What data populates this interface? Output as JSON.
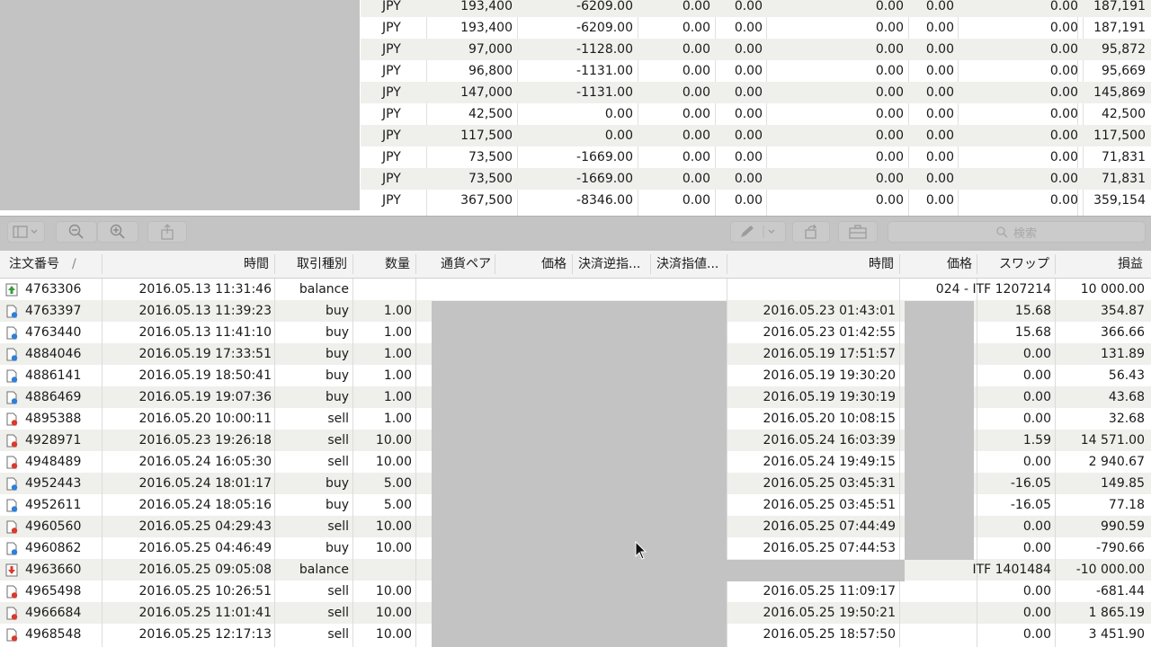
{
  "top_table": {
    "rows": [
      {
        "currency": "JPY",
        "c2": "193,400",
        "c3": "-6209.00",
        "c4": "0.00",
        "c5": "0.00",
        "c6": "0.00",
        "c7": "0.00",
        "c8": "0.00",
        "c9": "187,191"
      },
      {
        "currency": "JPY",
        "c2": "193,400",
        "c3": "-6209.00",
        "c4": "0.00",
        "c5": "0.00",
        "c6": "0.00",
        "c7": "0.00",
        "c8": "0.00",
        "c9": "187,191"
      },
      {
        "currency": "JPY",
        "c2": "97,000",
        "c3": "-1128.00",
        "c4": "0.00",
        "c5": "0.00",
        "c6": "0.00",
        "c7": "0.00",
        "c8": "0.00",
        "c9": "95,872"
      },
      {
        "currency": "JPY",
        "c2": "96,800",
        "c3": "-1131.00",
        "c4": "0.00",
        "c5": "0.00",
        "c6": "0.00",
        "c7": "0.00",
        "c8": "0.00",
        "c9": "95,669"
      },
      {
        "currency": "JPY",
        "c2": "147,000",
        "c3": "-1131.00",
        "c4": "0.00",
        "c5": "0.00",
        "c6": "0.00",
        "c7": "0.00",
        "c8": "0.00",
        "c9": "145,869"
      },
      {
        "currency": "JPY",
        "c2": "42,500",
        "c3": "0.00",
        "c4": "0.00",
        "c5": "0.00",
        "c6": "0.00",
        "c7": "0.00",
        "c8": "0.00",
        "c9": "42,500"
      },
      {
        "currency": "JPY",
        "c2": "117,500",
        "c3": "0.00",
        "c4": "0.00",
        "c5": "0.00",
        "c6": "0.00",
        "c7": "0.00",
        "c8": "0.00",
        "c9": "117,500"
      },
      {
        "currency": "JPY",
        "c2": "73,500",
        "c3": "-1669.00",
        "c4": "0.00",
        "c5": "0.00",
        "c6": "0.00",
        "c7": "0.00",
        "c8": "0.00",
        "c9": "71,831"
      },
      {
        "currency": "JPY",
        "c2": "73,500",
        "c3": "-1669.00",
        "c4": "0.00",
        "c5": "0.00",
        "c6": "0.00",
        "c7": "0.00",
        "c8": "0.00",
        "c9": "71,831"
      },
      {
        "currency": "JPY",
        "c2": "367,500",
        "c3": "-8346.00",
        "c4": "0.00",
        "c5": "0.00",
        "c6": "0.00",
        "c7": "0.00",
        "c8": "0.00",
        "c9": "359,154"
      }
    ]
  },
  "toolbar": {
    "search_placeholder": "検索",
    "icons": [
      "sidebar-toggle-icon",
      "zoom-out-icon",
      "zoom-in-icon",
      "share-icon",
      "pencil-icon",
      "rotate-icon",
      "briefcase-icon",
      "search-icon"
    ]
  },
  "grid": {
    "headers": {
      "order": "注文番号",
      "sort_indicator": "/",
      "open_time": "時間",
      "type": "取引種別",
      "volume": "数量",
      "pair": "通貨ペア",
      "price": "価格",
      "sl": "決済逆指...",
      "tp": "決済指値...",
      "close_time": "時間",
      "close_price": "価格",
      "swap": "スワップ",
      "profit": "損益"
    },
    "rows": [
      {
        "kind": "balance-in",
        "order": "4763306",
        "open_time": "2016.05.13 11:31:46",
        "type": "balance",
        "volume": "",
        "close_time": "",
        "comment": "024 - ITF 1207214",
        "swap": "",
        "profit": "10 000.00"
      },
      {
        "kind": "buy",
        "order": "4763397",
        "open_time": "2016.05.13 11:39:23",
        "type": "buy",
        "volume": "1.00",
        "close_time": "2016.05.23 01:43:01",
        "comment": "",
        "swap": "15.68",
        "profit": "354.87"
      },
      {
        "kind": "buy",
        "order": "4763440",
        "open_time": "2016.05.13 11:41:10",
        "type": "buy",
        "volume": "1.00",
        "close_time": "2016.05.23 01:42:55",
        "comment": "",
        "swap": "15.68",
        "profit": "366.66"
      },
      {
        "kind": "buy",
        "order": "4884046",
        "open_time": "2016.05.19 17:33:51",
        "type": "buy",
        "volume": "1.00",
        "close_time": "2016.05.19 17:51:57",
        "comment": "",
        "swap": "0.00",
        "profit": "131.89"
      },
      {
        "kind": "buy",
        "order": "4886141",
        "open_time": "2016.05.19 18:50:41",
        "type": "buy",
        "volume": "1.00",
        "close_time": "2016.05.19 19:30:20",
        "comment": "",
        "swap": "0.00",
        "profit": "56.43"
      },
      {
        "kind": "buy",
        "order": "4886469",
        "open_time": "2016.05.19 19:07:36",
        "type": "buy",
        "volume": "1.00",
        "close_time": "2016.05.19 19:30:19",
        "comment": "",
        "swap": "0.00",
        "profit": "43.68"
      },
      {
        "kind": "sell",
        "order": "4895388",
        "open_time": "2016.05.20 10:00:11",
        "type": "sell",
        "volume": "1.00",
        "close_time": "2016.05.20 10:08:15",
        "comment": "",
        "swap": "0.00",
        "profit": "32.68"
      },
      {
        "kind": "sell",
        "order": "4928971",
        "open_time": "2016.05.23 19:26:18",
        "type": "sell",
        "volume": "10.00",
        "close_time": "2016.05.24 16:03:39",
        "comment": "",
        "swap": "1.59",
        "profit": "14 571.00"
      },
      {
        "kind": "sell",
        "order": "4948489",
        "open_time": "2016.05.24 16:05:30",
        "type": "sell",
        "volume": "10.00",
        "close_time": "2016.05.24 19:49:15",
        "comment": "",
        "swap": "0.00",
        "profit": "2 940.67"
      },
      {
        "kind": "buy",
        "order": "4952443",
        "open_time": "2016.05.24 18:01:17",
        "type": "buy",
        "volume": "5.00",
        "close_time": "2016.05.25 03:45:31",
        "comment": "",
        "swap": "-16.05",
        "profit": "149.85"
      },
      {
        "kind": "buy",
        "order": "4952611",
        "open_time": "2016.05.24 18:05:16",
        "type": "buy",
        "volume": "5.00",
        "close_time": "2016.05.25 03:45:51",
        "comment": "",
        "swap": "-16.05",
        "profit": "77.18"
      },
      {
        "kind": "sell",
        "order": "4960560",
        "open_time": "2016.05.25 04:29:43",
        "type": "sell",
        "volume": "10.00",
        "close_time": "2016.05.25 07:44:49",
        "comment": "",
        "swap": "0.00",
        "profit": "990.59"
      },
      {
        "kind": "buy",
        "order": "4960862",
        "open_time": "2016.05.25 04:46:49",
        "type": "buy",
        "volume": "10.00",
        "close_time": "2016.05.25 07:44:53",
        "comment": "",
        "swap": "0.00",
        "profit": "-790.66"
      },
      {
        "kind": "balance-out",
        "order": "4963660",
        "open_time": "2016.05.25 09:05:08",
        "type": "balance",
        "volume": "",
        "close_time": "",
        "comment": "ITF 1401484",
        "swap": "",
        "profit": "-10 000.00"
      },
      {
        "kind": "sell",
        "order": "4965498",
        "open_time": "2016.05.25 10:26:51",
        "type": "sell",
        "volume": "10.00",
        "close_time": "2016.05.25 11:09:17",
        "comment": "",
        "swap": "0.00",
        "profit": "-681.44"
      },
      {
        "kind": "sell",
        "order": "4966684",
        "open_time": "2016.05.25 11:01:41",
        "type": "sell",
        "volume": "10.00",
        "close_time": "2016.05.25 19:50:21",
        "comment": "",
        "swap": "0.00",
        "profit": "1 865.19"
      },
      {
        "kind": "sell",
        "order": "4968548",
        "open_time": "2016.05.25 12:17:13",
        "type": "sell",
        "volume": "10.00",
        "close_time": "2016.05.25 18:57:50",
        "comment": "",
        "swap": "0.00",
        "profit": "3 451.90"
      }
    ]
  },
  "colors": {
    "buy_icon": "#2f7fd6",
    "sell_icon": "#d93a2e",
    "balance_in_icon": "#3a9a3a",
    "balance_out_icon": "#d93a2e",
    "redaction": "#c3c3c3",
    "row_alt": "#efefec"
  }
}
